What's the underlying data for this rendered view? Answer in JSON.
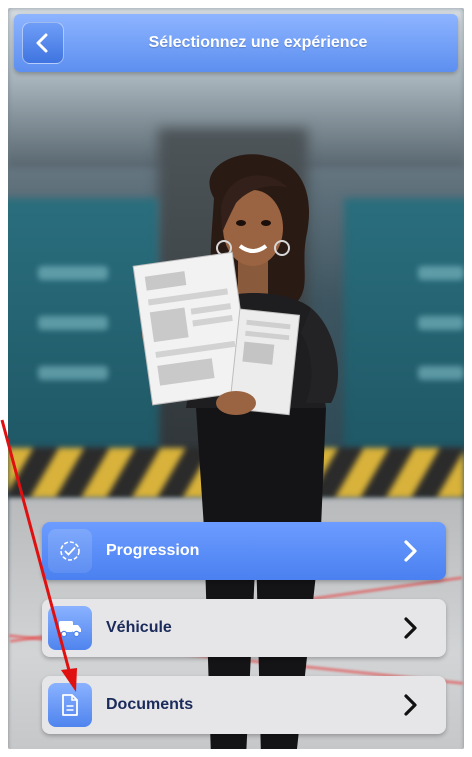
{
  "header": {
    "title": "Sélectionnez une expérience",
    "back_icon": "chevron-left-icon"
  },
  "menu": {
    "items": [
      {
        "label": "Progression",
        "icon": "check-circle-icon",
        "state": "active"
      },
      {
        "label": "Véhicule",
        "icon": "truck-icon",
        "state": "inactive"
      },
      {
        "label": "Documents",
        "icon": "document-icon",
        "state": "inactive"
      }
    ]
  },
  "colors": {
    "accent": "#5d8ff0",
    "active_item": "#5a8ef5",
    "inactive_item": "#e6e6e8",
    "inactive_text": "#1a2a5a",
    "annotation_arrow": "#e01010"
  }
}
